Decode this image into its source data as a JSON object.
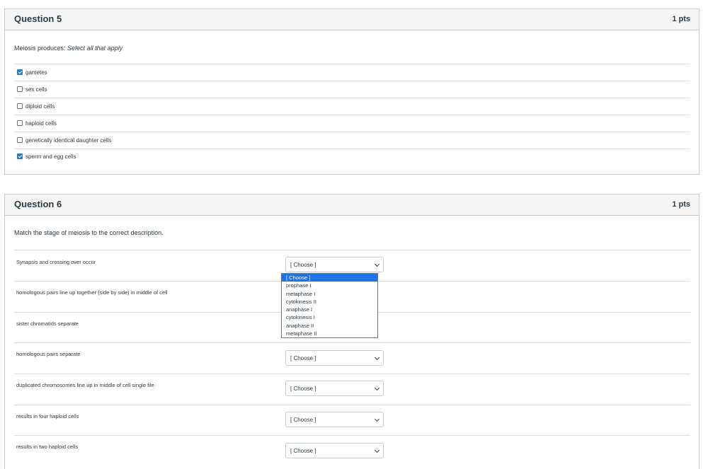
{
  "q5": {
    "title": "Question 5",
    "points": "1 pts",
    "prompt": "Meiosis produces: ",
    "prompt_italic": "Select all that apply",
    "answers": [
      {
        "label": "gametes",
        "checked": true
      },
      {
        "label": "sex cells",
        "checked": false
      },
      {
        "label": "diploid cells",
        "checked": false
      },
      {
        "label": "haploid cells",
        "checked": false
      },
      {
        "label": "genetically identical daughter cells",
        "checked": false
      },
      {
        "label": "sperm and egg cells",
        "checked": true
      }
    ]
  },
  "q6": {
    "title": "Question 6",
    "points": "1 pts",
    "prompt": "Match the stage of meiosis to the correct description.",
    "rows": [
      {
        "text": "Synapsis and crossing over occur",
        "selected": "[ Choose ]"
      },
      {
        "text": "homologous pairs line up together (side by side) in middle of cell",
        "selected": ""
      },
      {
        "text": "sister chromatids separate",
        "selected": ""
      },
      {
        "text": "homologous pairs separate",
        "selected": "[ Choose ]"
      },
      {
        "text": "duplicated chromosomes line up in middle of cell single file",
        "selected": "[ Choose ]"
      },
      {
        "text": "results in four haploid cells",
        "selected": "[ Choose ]"
      },
      {
        "text": "results in two haploid cells",
        "selected": "[ Choose ]"
      }
    ],
    "dropdown_options": [
      "[ Choose ]",
      "prophase I",
      "metaphase I",
      "cytokinesis II",
      "anaphase I",
      "cytokinesis I",
      "anaphase II",
      "metaphase II"
    ]
  }
}
